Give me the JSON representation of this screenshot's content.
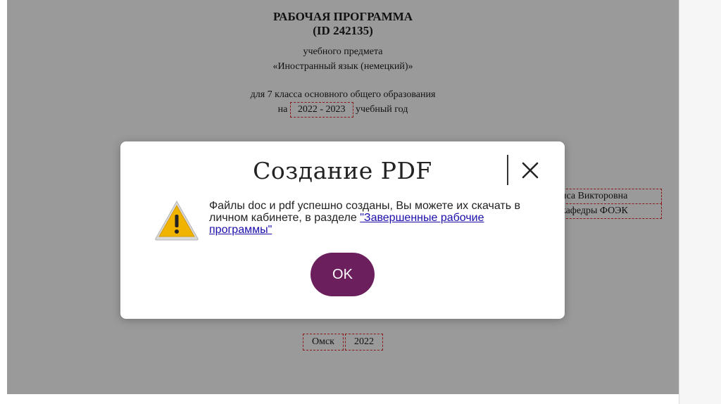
{
  "document": {
    "title": "РАБОЧАЯ ПРОГРАММА",
    "id": "(ID 242135)",
    "subject_line1": "учебного предмета",
    "subject_line2": "«Иностранный язык (немецкий)»",
    "class_line": "для 7 класса основного общего образования",
    "year_prefix": "на",
    "year_value": "2022 - 2023",
    "year_suffix": "учебный год",
    "author_line1": "нса Викторовна",
    "author_line2": "кафедры ФОЭК",
    "city": "Омск",
    "year": "2022"
  },
  "modal": {
    "title": "Создание PDF",
    "message": "Файлы doc и pdf успешно созданы, Вы можете их скачать в личном кабинете, в разделе ",
    "link_text": "\"Завершенные рабочие программы\"",
    "ok_label": "OK",
    "close_icon": "close-icon",
    "warning_icon": "warning-icon"
  },
  "colors": {
    "overlay": "#9a9a9a",
    "ok_button": "#6b1f5d",
    "warning": "#f0b400",
    "link": "#1a0dab"
  }
}
